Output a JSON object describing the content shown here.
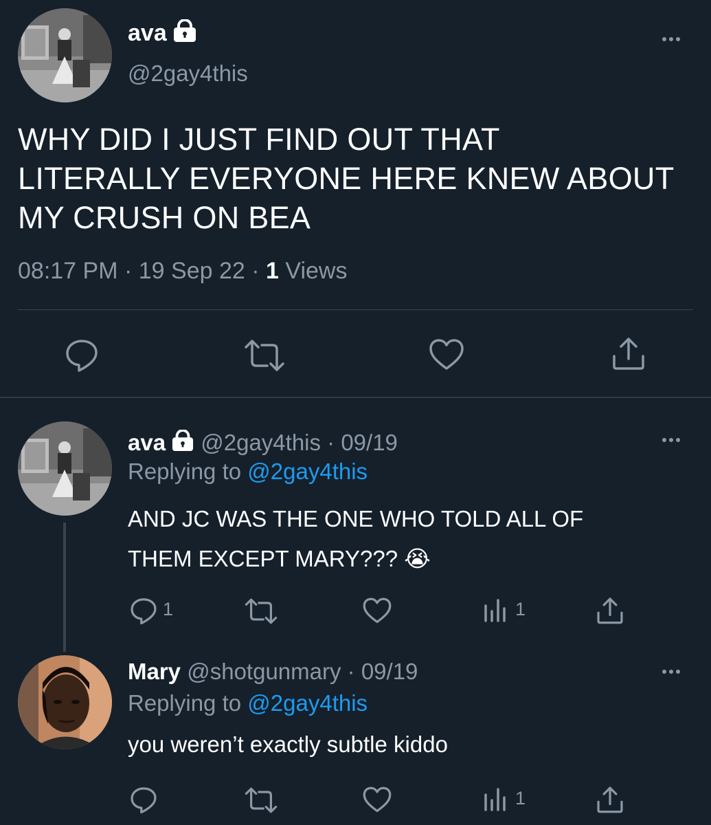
{
  "main_tweet": {
    "author_name": "ava",
    "author_handle": "@2gay4this",
    "text_line1": "WHY DID I JUST FIND OUT THAT",
    "text_line2": "LITERALLY EVERYONE HERE KNEW ABOUT",
    "text_line3": "MY CRUSH ON BEA",
    "time": "08:17 PM",
    "date": "19 Sep 22",
    "separator": "·",
    "views_count": "1",
    "views_label": "Views"
  },
  "reply1": {
    "author_name": "ava",
    "author_handle": "@2gay4this",
    "date": "· 09/19",
    "replying_label": "Replying to",
    "replying_handle": "@2gay4this",
    "text_line1": "AND JC WAS THE ONE WHO TOLD ALL OF",
    "text_line2": "THEM EXCEPT MARY???",
    "emoji": "😭",
    "reply_count": "1",
    "views_count": "1"
  },
  "reply2": {
    "author_name": "Mary",
    "author_handle": "@shotgunmary",
    "date": "· 09/19",
    "replying_label": "Replying to",
    "replying_handle": "@2gay4this",
    "text": "you weren’t exactly subtle kiddo",
    "views_count": "1"
  },
  "colors": {
    "background": "#15202b",
    "text": "#ffffff",
    "muted": "#8b98a5",
    "link": "#1d9bf0",
    "divider": "#38444d"
  }
}
